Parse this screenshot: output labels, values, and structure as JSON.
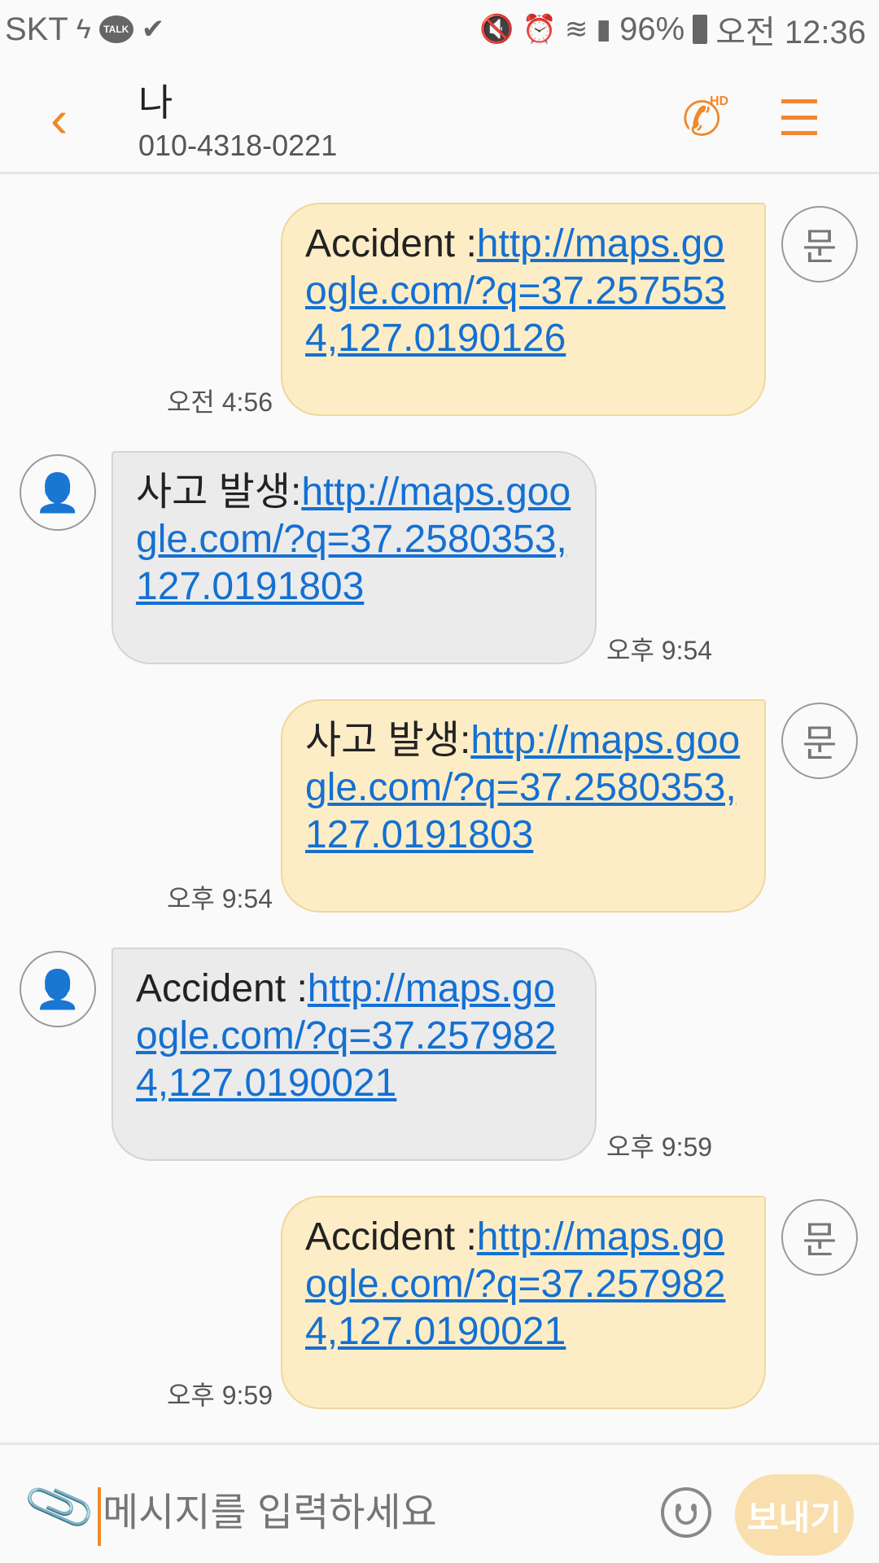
{
  "status_bar": {
    "carrier": "SKT",
    "talk": "TALK",
    "battery": "96%",
    "time": "오전 12:36"
  },
  "header": {
    "title": "나",
    "phone": "010-4318-0221",
    "call_badge": "HD"
  },
  "messages": [
    {
      "dir": "sent",
      "prefix": "Accident :",
      "url": "http://maps.google.com/?q=37.2575534,127.0190126",
      "time": "오전 4:56",
      "avatar": "문"
    },
    {
      "dir": "recv",
      "prefix": "사고 발생:",
      "url": "http://maps.google.com/?q=37.2580353,127.0191803",
      "time": "오후 9:54"
    },
    {
      "dir": "sent",
      "prefix": "사고 발생:",
      "url": "http://maps.google.com/?q=37.2580353,127.0191803",
      "time": "오후 9:54",
      "avatar": "문"
    },
    {
      "dir": "recv",
      "prefix": "Accident :",
      "url": "http://maps.google.com/?q=37.2579824,127.0190021",
      "time": "오후 9:59"
    },
    {
      "dir": "sent",
      "prefix": "Accident :",
      "url": "http://maps.google.com/?q=37.2579824,127.0190021",
      "time": "오후 9:59",
      "avatar": "문"
    }
  ],
  "composer": {
    "placeholder": "메시지를 입력하세요",
    "send_label": "보내기"
  }
}
